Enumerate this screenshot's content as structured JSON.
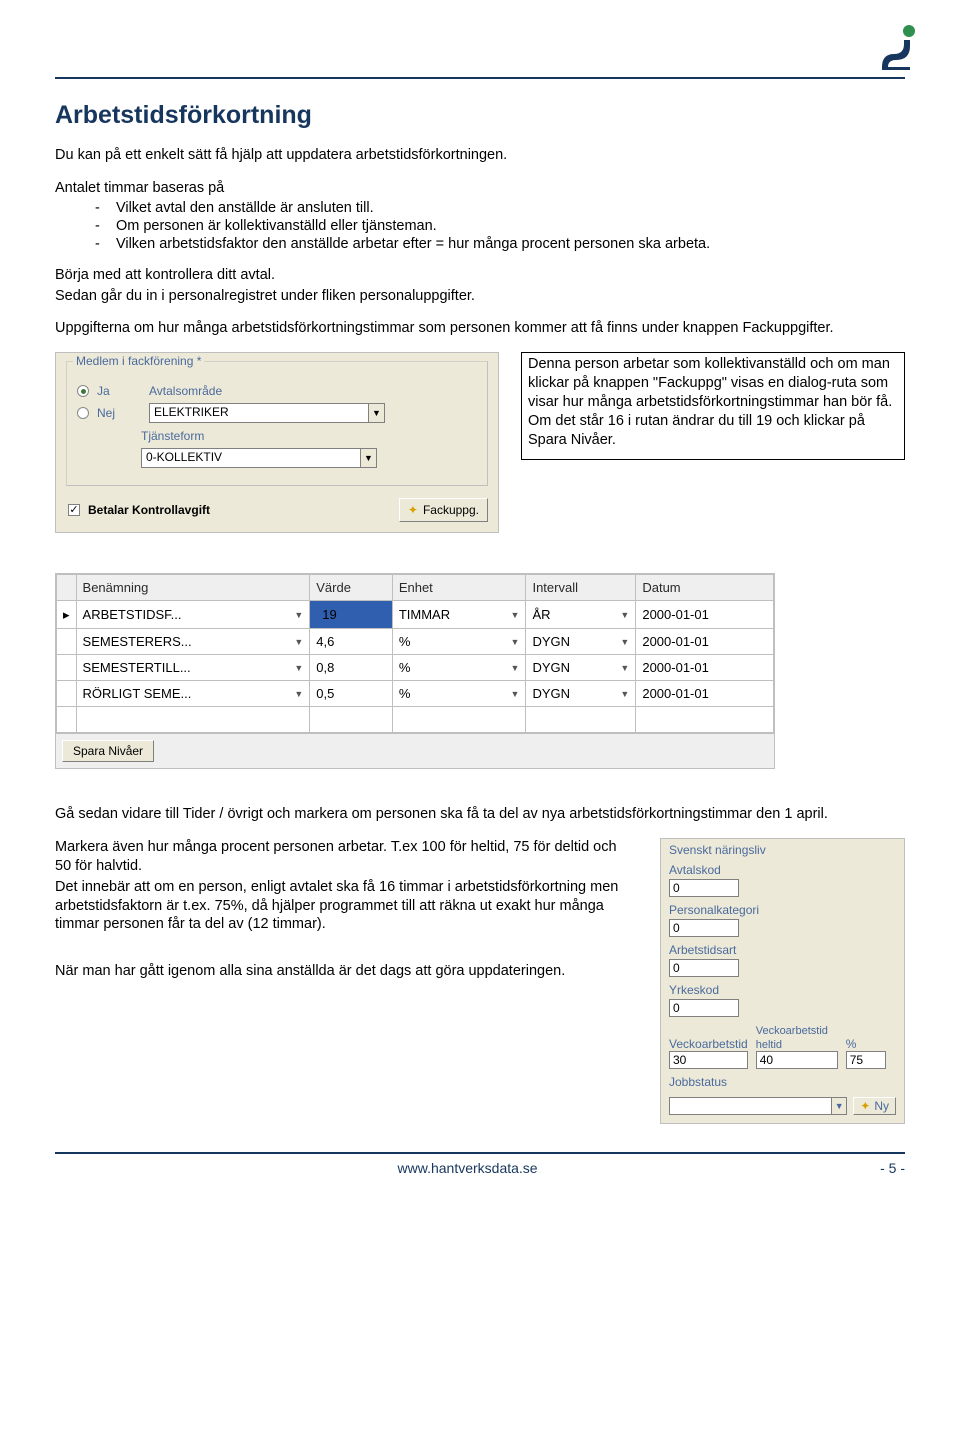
{
  "header": {
    "title": "Arbetstidsförkortning"
  },
  "intro": {
    "p1": "Du kan på ett enkelt sätt få hjälp att uppdatera arbetstidsförkortningen.",
    "p2": "Antalet timmar baseras på",
    "bullets": [
      "-    Vilket avtal den anställde är ansluten till.",
      "-    Om personen är kollektivanställd eller tjänsteman.",
      "-    Vilken arbetstidsfaktor den anställde arbetar efter = hur många procent personen ska arbeta."
    ],
    "p3": "Börja med att kontrollera ditt avtal.",
    "p4": "Sedan går du in i personalregistret under fliken personaluppgifter.",
    "p5": "Uppgifterna om hur många arbetstidsförkortningstimmar som personen kommer att få finns under knappen Fackuppgifter."
  },
  "union_panel": {
    "legend": "Medlem i fackförening *",
    "ja": "Ja",
    "nej": "Nej",
    "avtalsomrade_label": "Avtalsområde",
    "avtalsomrade_value": "ELEKTRIKER",
    "tjansteform_label": "Tjänsteform",
    "tjansteform_value": "0-KOLLEKTIV",
    "betalar": "Betalar Kontrollavgift",
    "fackuppg_btn": "Fackuppg."
  },
  "callout": {
    "l1": "Denna person arbetar som  kollektivanställd och om man klickar på knappen \"Fackuppg\" visas en dialog-ruta som visar hur många arbetstidsförkortningstimmar han bör få.",
    "l2": "Om det står 16 i rutan ändrar du till 19 och klickar på Spara Nivåer."
  },
  "grid": {
    "headers": [
      "Benämning",
      "Värde",
      "Enhet",
      "Intervall",
      "Datum"
    ],
    "rows": [
      {
        "ben": "ARBETSTIDSF...",
        "varde": "19",
        "enhet": "TIMMAR",
        "intervall": "ÅR",
        "datum": "2000-01-01",
        "sel": true
      },
      {
        "ben": "SEMESTERERS...",
        "varde": "4,6",
        "enhet": "%",
        "intervall": "DYGN",
        "datum": "2000-01-01",
        "sel": false
      },
      {
        "ben": "SEMESTERTILL...",
        "varde": "0,8",
        "enhet": "%",
        "intervall": "DYGN",
        "datum": "2000-01-01",
        "sel": false
      },
      {
        "ben": "RÖRLIGT SEME...",
        "varde": "0,5",
        "enhet": "%",
        "intervall": "DYGN",
        "datum": "2000-01-01",
        "sel": false
      }
    ],
    "spara": "Spara Nivåer"
  },
  "after_grid": {
    "p1": "Gå sedan vidare till Tider / övrigt och markera om personen ska få ta del av nya arbetstidsförkortningstimmar den 1 april.",
    "p2": "Markera även hur många procent personen arbetar. T.ex 100 för heltid, 75 för deltid och 50 för halvtid.",
    "p3": "Det innebär att om en person, enligt avtalet ska få 16 timmar i arbetstidsförkortning men arbetstidsfaktorn är t.ex. 75%, då hjälper programmet till att räkna ut exakt hur många timmar personen får ta del av (12 timmar).",
    "p4": "När man har gått igenom alla sina anställda är det dags att göra uppdateringen."
  },
  "sv_panel": {
    "legend": "Svenskt näringsliv",
    "avtalskod": "Avtalskod",
    "avtalskod_v": "0",
    "personalkategori": "Personalkategori",
    "personalkategori_v": "0",
    "arbetstidsart": "Arbetstidsart",
    "arbetstidsart_v": "0",
    "yrkeskod": "Yrkeskod",
    "yrkeskod_v": "0",
    "veckoarbetstid": "Veckoarbetstid",
    "veckoarbetstid_v": "30",
    "veckoheltid": "Veckoarbetstid heltid",
    "veckoheltid_v": "40",
    "pct_label": "%",
    "pct_v": "75",
    "jobbstatus": "Jobbstatus",
    "jobbstatus_v": "",
    "ny": "Ny"
  },
  "footer": {
    "url": "www.hantverksdata.se",
    "page": "- 5 -"
  }
}
